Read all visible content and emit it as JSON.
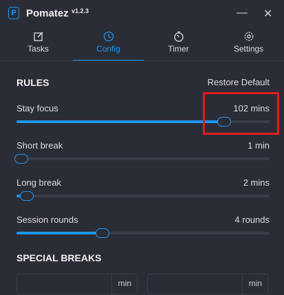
{
  "app": {
    "name": "Pomatez",
    "version": "v1.2.3",
    "logo_letter": "P"
  },
  "window": {
    "minimize_glyph": "—",
    "close_glyph": "✕"
  },
  "tabs": [
    {
      "label": "Tasks",
      "icon": "edit-icon",
      "active": false
    },
    {
      "label": "Config",
      "icon": "clock-icon",
      "active": true
    },
    {
      "label": "Timer",
      "icon": "timer-icon",
      "active": false
    },
    {
      "label": "Settings",
      "icon": "gear-icon",
      "active": false
    }
  ],
  "rules": {
    "title": "RULES",
    "restore_label": "Restore Default",
    "items": [
      {
        "label": "Stay focus",
        "value": "102 mins",
        "fraction": 0.82
      },
      {
        "label": "Short break",
        "value": "1 min",
        "fraction": 0.02
      },
      {
        "label": "Long break",
        "value": "2 mins",
        "fraction": 0.04
      },
      {
        "label": "Session rounds",
        "value": "4 rounds",
        "fraction": 0.34
      }
    ]
  },
  "special_breaks": {
    "title": "SPECIAL BREAKS",
    "unit_label": "min"
  },
  "colors": {
    "accent": "#1e96f0",
    "background": "#2b2d36",
    "highlight": "#e01e1e"
  }
}
